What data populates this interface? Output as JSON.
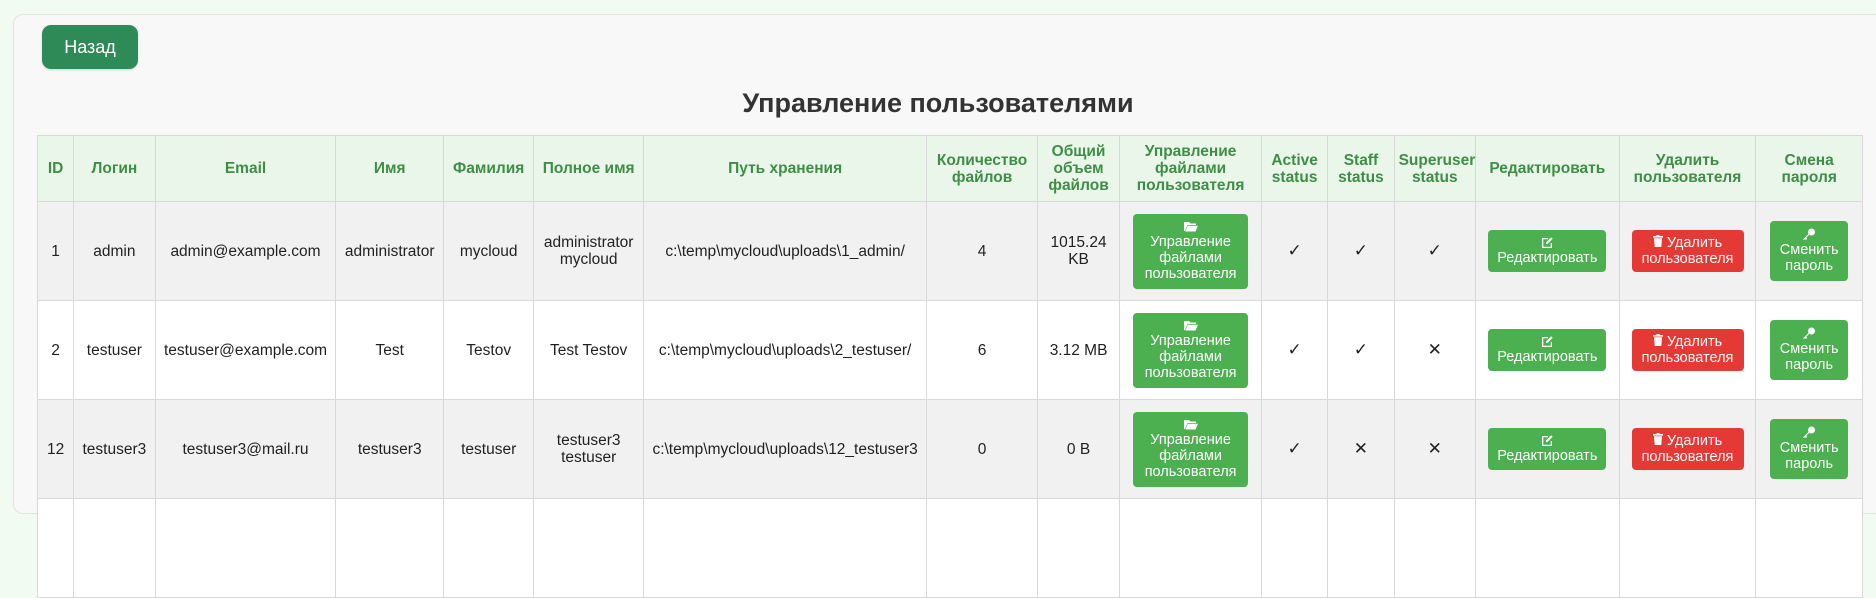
{
  "back_label": "Назад",
  "title": "Управление пользователями",
  "columns": [
    "ID",
    "Логин",
    "Email",
    "Имя",
    "Фамилия",
    "Полное имя",
    "Путь хранения",
    "Количество файлов",
    "Общий объем файлов",
    "Управление файлами пользователя",
    "Active status",
    "Staff status",
    "Superuser status",
    "Редактировать",
    "Удалить пользователя",
    "Смена пароля"
  ],
  "rows": [
    {
      "id": "1",
      "login": "admin",
      "email": "admin@example.com",
      "first_name": "administrator",
      "last_name": "mycloud",
      "full_name": "administrator mycloud",
      "path": "c:\\temp\\mycloud\\uploads\\1_admin/",
      "file_count": "4",
      "total_size": "1015.24 KB",
      "active": "✓",
      "staff": "✓",
      "superuser": "✓"
    },
    {
      "id": "2",
      "login": "testuser",
      "email": "testuser@example.com",
      "first_name": "Test",
      "last_name": "Testov",
      "full_name": "Test Testov",
      "path": "c:\\temp\\mycloud\\uploads\\2_testuser/",
      "file_count": "6",
      "total_size": "3.12 MB",
      "active": "✓",
      "staff": "✓",
      "superuser": "✕"
    },
    {
      "id": "12",
      "login": "testuser3",
      "email": "testuser3@mail.ru",
      "first_name": "testuser3",
      "last_name": "testuser",
      "full_name": "testuser3 testuser",
      "path": "c:\\temp\\mycloud\\uploads\\12_testuser3",
      "file_count": "0",
      "total_size": "0 B",
      "active": "✓",
      "staff": "✕",
      "superuser": "✕"
    }
  ],
  "actions": {
    "files_label": "Управление файлами пользователя",
    "edit_label": "Редактировать",
    "delete_label": "Удалить пользователя",
    "password_label": "Сменить пароль"
  },
  "icons": {
    "files": "folder-open-icon",
    "edit": "edit-icon",
    "delete": "trash-icon",
    "password": "key-icon"
  },
  "colors": {
    "primary_green": "#2e8b57",
    "button_green": "#4caf50",
    "danger_red": "#e53935",
    "header_text": "#3f8e47",
    "header_bg": "#e9f6e9"
  }
}
